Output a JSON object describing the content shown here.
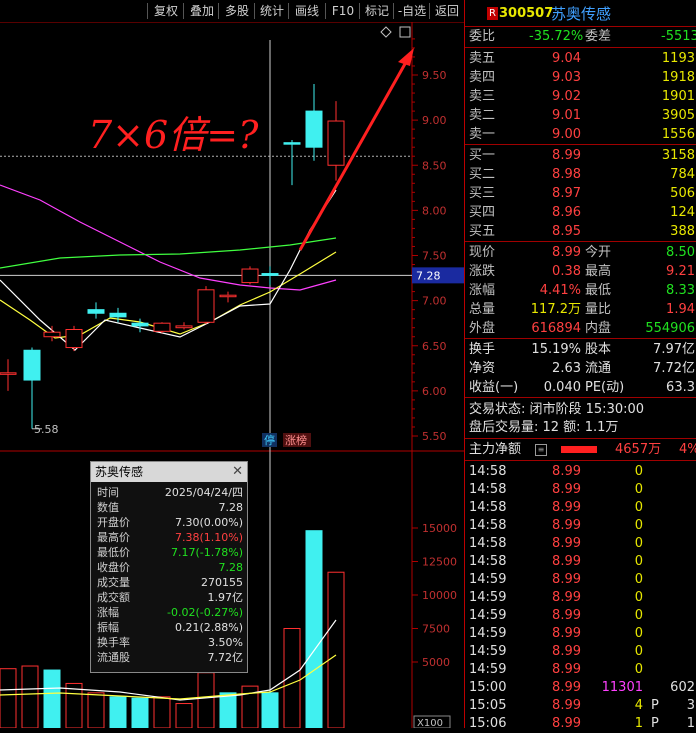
{
  "toolbar": {
    "buttons": [
      "复权",
      "叠加",
      "多股",
      "统计",
      "画线",
      "F10",
      "标记",
      "-自选",
      "返回"
    ]
  },
  "chart": {
    "price_axis": [
      "9.50",
      "9.00",
      "8.50",
      "8.00",
      "7.50",
      "7.00",
      "6.50",
      "6.00",
      "5.50"
    ],
    "volume_axis": [
      "15000",
      "12500",
      "10000",
      "7500",
      "5000"
    ],
    "current_price_tag": "7.28",
    "low_label": "5.58",
    "volume_unit": "X100",
    "annotation_text": "7×6倍=?",
    "badge_limit": "停",
    "badge_zhangbang": "涨榜",
    "colors": {
      "up": "#ff3030",
      "down": "#40f0f0",
      "ma5": "#ffffff",
      "ma10": "#ffff40",
      "ma20": "#ff40ff",
      "ma60": "#40ff40",
      "annot": "#ff2020"
    }
  },
  "tooltip": {
    "title": "苏奥传感",
    "rows": [
      {
        "k": "时间",
        "v": "2025/04/24/四",
        "c": "white"
      },
      {
        "k": "数值",
        "v": "7.28",
        "c": "white"
      },
      {
        "k": "开盘价",
        "v": "7.30(0.00%)",
        "c": "white"
      },
      {
        "k": "最高价",
        "v": "7.38(1.10%)",
        "c": "red"
      },
      {
        "k": "最低价",
        "v": "7.17(-1.78%)",
        "c": "green"
      },
      {
        "k": "收盘价",
        "v": "7.28",
        "c": "green"
      },
      {
        "k": "成交量",
        "v": "270155",
        "c": "white"
      },
      {
        "k": "成交额",
        "v": "1.97亿",
        "c": "white"
      },
      {
        "k": "涨幅",
        "v": "-0.02(-0.27%)",
        "c": "green"
      },
      {
        "k": "振幅",
        "v": "0.21(2.88%)",
        "c": "white"
      },
      {
        "k": "换手率",
        "v": "3.50%",
        "c": "white"
      },
      {
        "k": "流通股",
        "v": "7.72亿",
        "c": "white"
      }
    ]
  },
  "panel": {
    "r_badge": "R",
    "code": "300507",
    "name": "苏奥传感",
    "weibi_label": "委比",
    "weibi": "-35.72%",
    "weicha_label": "委差",
    "weicha": "-5513",
    "asks": [
      {
        "label": "卖五",
        "price": "9.04",
        "vol": "1193"
      },
      {
        "label": "卖四",
        "price": "9.03",
        "vol": "1918"
      },
      {
        "label": "卖三",
        "price": "9.02",
        "vol": "1901"
      },
      {
        "label": "卖二",
        "price": "9.01",
        "vol": "3905"
      },
      {
        "label": "卖一",
        "price": "9.00",
        "vol": "1556"
      }
    ],
    "bids": [
      {
        "label": "买一",
        "price": "8.99",
        "vol": "3158"
      },
      {
        "label": "买二",
        "price": "8.98",
        "vol": "784"
      },
      {
        "label": "买三",
        "price": "8.97",
        "vol": "506"
      },
      {
        "label": "买四",
        "price": "8.96",
        "vol": "124"
      },
      {
        "label": "买五",
        "price": "8.95",
        "vol": "388"
      }
    ],
    "quote": [
      {
        "l1": "现价",
        "v1": "8.99",
        "c1": "red",
        "l2": "今开",
        "v2": "8.50",
        "c2": "green"
      },
      {
        "l1": "涨跌",
        "v1": "0.38",
        "c1": "red",
        "l2": "最高",
        "v2": "9.21",
        "c2": "red"
      },
      {
        "l1": "涨幅",
        "v1": "4.41%",
        "c1": "red",
        "l2": "最低",
        "v2": "8.33",
        "c2": "green"
      },
      {
        "l1": "总量",
        "v1": "117.2万",
        "c1": "yellow",
        "l2": "量比",
        "v2": "1.94",
        "c2": "red"
      },
      {
        "l1": "外盘",
        "v1": "616894",
        "c1": "red",
        "l2": "内盘",
        "v2": "554906",
        "c2": "green"
      }
    ],
    "stats": [
      {
        "l1": "换手",
        "v1": "15.19%",
        "l2": "股本",
        "v2": "7.97亿"
      },
      {
        "l1": "净资",
        "v1": "2.63",
        "l2": "流通",
        "v2": "7.72亿"
      },
      {
        "l1": "收益(一)",
        "v1": "0.040",
        "l2": "PE(动)",
        "v2": "63.3"
      }
    ],
    "status_line": "交易状态: 闭市阶段 15:30:00",
    "after_line": "盘后交易量: 12  额: 1.1万",
    "main_label": "主力净额",
    "main_value": "4657万",
    "main_pct": "4%",
    "ticks": [
      {
        "t": "14:58",
        "p": "8.99",
        "v": "0",
        "x": "",
        "y": ""
      },
      {
        "t": "14:58",
        "p": "8.99",
        "v": "0",
        "x": "",
        "y": ""
      },
      {
        "t": "14:58",
        "p": "8.99",
        "v": "0",
        "x": "",
        "y": ""
      },
      {
        "t": "14:58",
        "p": "8.99",
        "v": "0",
        "x": "",
        "y": ""
      },
      {
        "t": "14:58",
        "p": "8.99",
        "v": "0",
        "x": "",
        "y": ""
      },
      {
        "t": "14:58",
        "p": "8.99",
        "v": "0",
        "x": "",
        "y": ""
      },
      {
        "t": "14:59",
        "p": "8.99",
        "v": "0",
        "x": "",
        "y": ""
      },
      {
        "t": "14:59",
        "p": "8.99",
        "v": "0",
        "x": "",
        "y": ""
      },
      {
        "t": "14:59",
        "p": "8.99",
        "v": "0",
        "x": "",
        "y": ""
      },
      {
        "t": "14:59",
        "p": "8.99",
        "v": "0",
        "x": "",
        "y": ""
      },
      {
        "t": "14:59",
        "p": "8.99",
        "v": "0",
        "x": "",
        "y": ""
      },
      {
        "t": "14:59",
        "p": "8.99",
        "v": "0",
        "x": "",
        "y": ""
      },
      {
        "t": "15:00",
        "p": "8.99",
        "v": "11301",
        "x": "",
        "y": "602"
      },
      {
        "t": "15:05",
        "p": "8.99",
        "v": "4",
        "x": "P",
        "y": "3"
      },
      {
        "t": "15:06",
        "p": "8.99",
        "v": "1",
        "x": "P",
        "y": "1"
      }
    ]
  }
}
